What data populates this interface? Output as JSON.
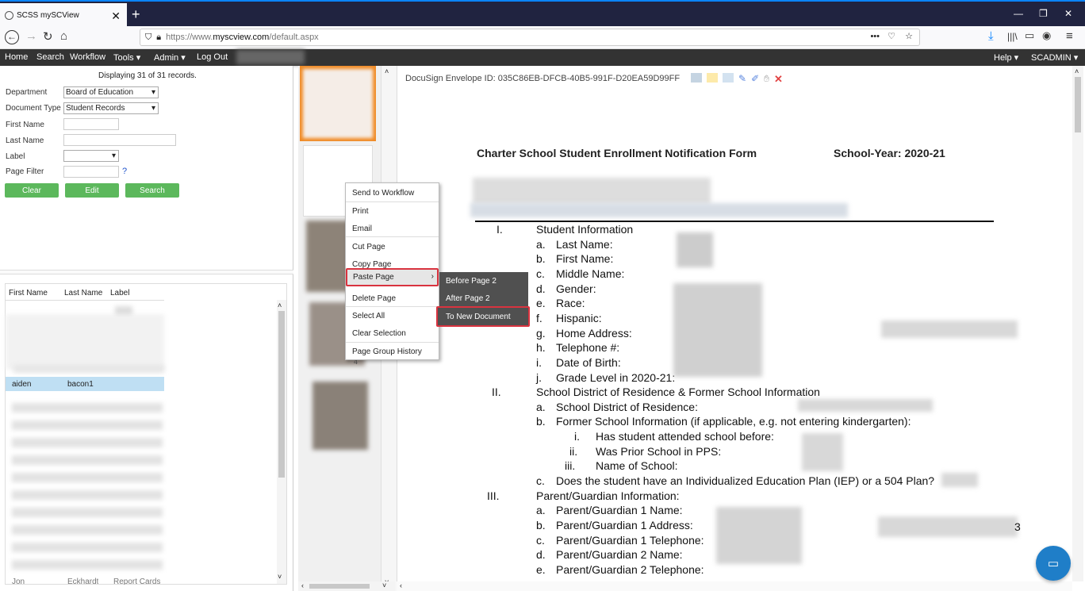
{
  "browser": {
    "tab_title": "SCSS mySCView",
    "new_tab": "+",
    "url_prefix": "https://www.",
    "url_domain": "myscview.com",
    "url_path": "/default.aspx",
    "url_dots": "•••"
  },
  "menu": {
    "items": [
      "Home",
      "Search",
      "Workflow",
      "Tools ▾",
      "Admin ▾",
      "Log Out"
    ],
    "help": "Help ▾",
    "user": "SCADMIN ▾"
  },
  "search": {
    "records": "Displaying 31 of 31 records.",
    "department_label": "Department",
    "department_value": "Board of Education",
    "doctype_label": "Document Type",
    "doctype_value": "Student Records",
    "first_name_label": "First Name",
    "last_name_label": "Last Name",
    "label_label": "Label",
    "page_filter_label": "Page Filter",
    "help_mark": "?",
    "clear_btn": "Clear",
    "edit_btn": "Edit",
    "search_btn": "Search"
  },
  "grid": {
    "col_first": "First Name",
    "col_last": "Last Name",
    "col_label": "Label",
    "selected_first": "aiden",
    "selected_last": "bacon1",
    "bottom_first": "Jon",
    "bottom_last": "Eckhardt",
    "bottom_label": "Report Cards"
  },
  "context_menu": {
    "items": [
      "Send to Workflow",
      "Print",
      "Email",
      "Cut Page",
      "Copy Page",
      "Paste Page",
      "Delete Page",
      "Select All",
      "Clear Selection",
      "Page Group History"
    ],
    "submenu": [
      "Before Page 2",
      "After Page 2",
      "To New Document"
    ]
  },
  "thumb_label": "4",
  "document": {
    "envelope": "DocuSign Envelope ID: 035C86EB-DFCB-40B5-991F-D20EA59D99FF",
    "title": "Charter School Student Enrollment Notification Form",
    "year": "School-Year: 2020-21",
    "lines": [
      [
        "I.",
        "Student Information",
        0
      ],
      [
        "a.",
        "Last Name:",
        1
      ],
      [
        "b.",
        "First Name:",
        1
      ],
      [
        "c.",
        "Middle Name:",
        1
      ],
      [
        "d.",
        "Gender:",
        1
      ],
      [
        "e.",
        "Race:",
        1
      ],
      [
        "f.",
        "Hispanic:",
        1
      ],
      [
        "g.",
        "Home Address:",
        1
      ],
      [
        "h.",
        "Telephone #:",
        1
      ],
      [
        "i.",
        "Date of Birth:",
        1
      ],
      [
        "j.",
        "Grade Level in 2020-21:",
        1
      ],
      [
        "II.",
        "School District of Residence & Former School Information",
        0
      ],
      [
        "a.",
        "School District of Residence:",
        1
      ],
      [
        "b.",
        "Former School Information (if applicable, e.g. not entering kindergarten):",
        1
      ],
      [
        "i.",
        "Has student attended school before:",
        2
      ],
      [
        "ii.",
        "Was Prior School in PPS:",
        2
      ],
      [
        "iii.",
        "Name of School:",
        2
      ],
      [
        "c.",
        "Does the student have an Individualized Education Plan (IEP) or a 504 Plan?",
        1
      ],
      [
        "III.",
        "Parent/Guardian Information:",
        0
      ],
      [
        "a.",
        "Parent/Guardian 1 Name:",
        1
      ],
      [
        "b.",
        "Parent/Guardian 1 Address:",
        1
      ],
      [
        "c.",
        "Parent/Guardian 1 Telephone:",
        1
      ],
      [
        "d.",
        "Parent/Guardian 2 Name:",
        1
      ],
      [
        "e.",
        "Parent/Guardian 2 Telephone:",
        1
      ]
    ],
    "trailing_char": "3"
  }
}
